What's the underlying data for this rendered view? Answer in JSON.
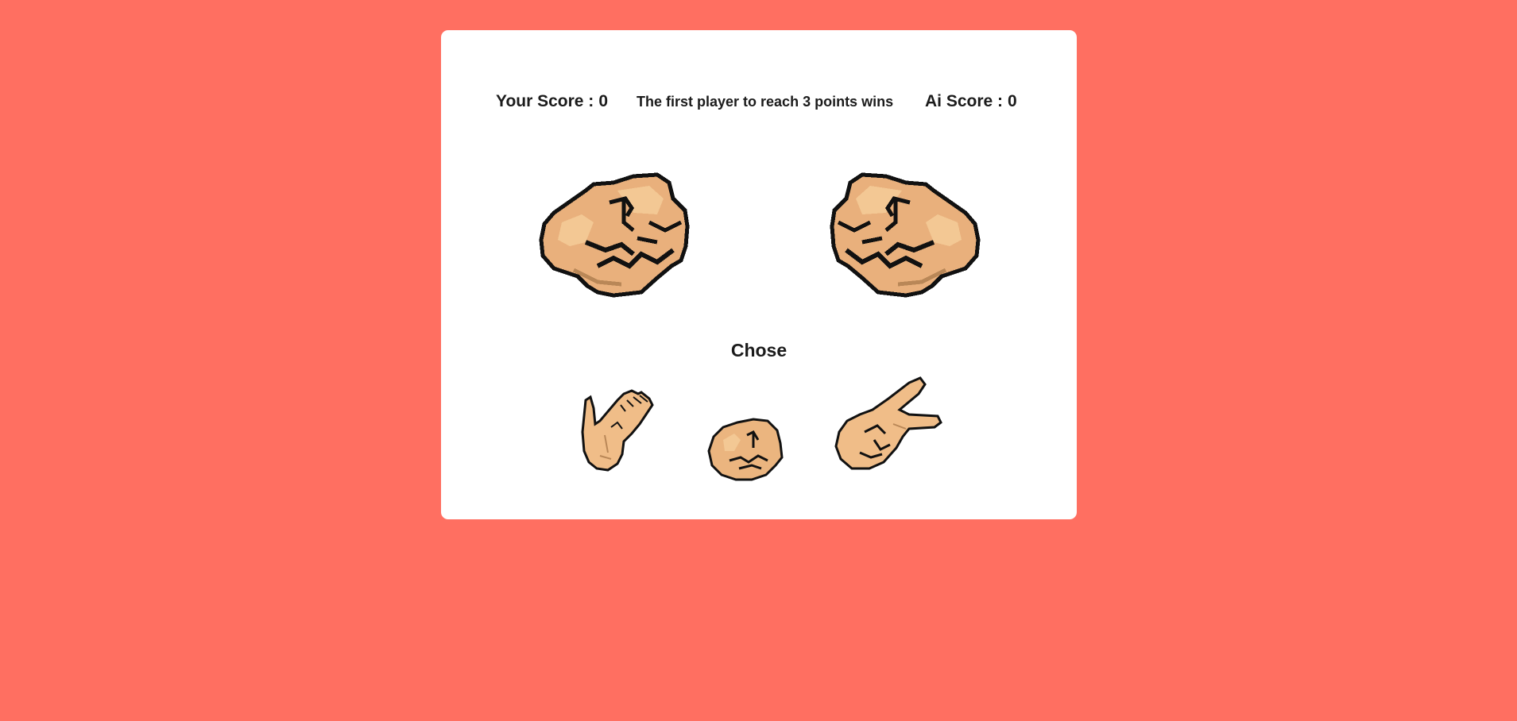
{
  "scoreboard": {
    "player_label": "Your Score :",
    "player_score": "0",
    "rule_text": "The first player to reach 3 points wins",
    "ai_label": "Ai Score :",
    "ai_score": "0"
  },
  "arena": {
    "player_hand": "rock-fist-icon",
    "ai_hand": "rock-fist-icon"
  },
  "choose_label": "Chose",
  "choices": [
    {
      "name": "paper",
      "icon": "paper-hand-icon"
    },
    {
      "name": "rock",
      "icon": "rock-fist-icon"
    },
    {
      "name": "scissors",
      "icon": "scissors-hand-icon"
    }
  ],
  "colors": {
    "background": "#ff6f61",
    "card": "#ffffff",
    "skin": "#e9b07c",
    "skin_light": "#f3c894",
    "outline": "#111111"
  }
}
